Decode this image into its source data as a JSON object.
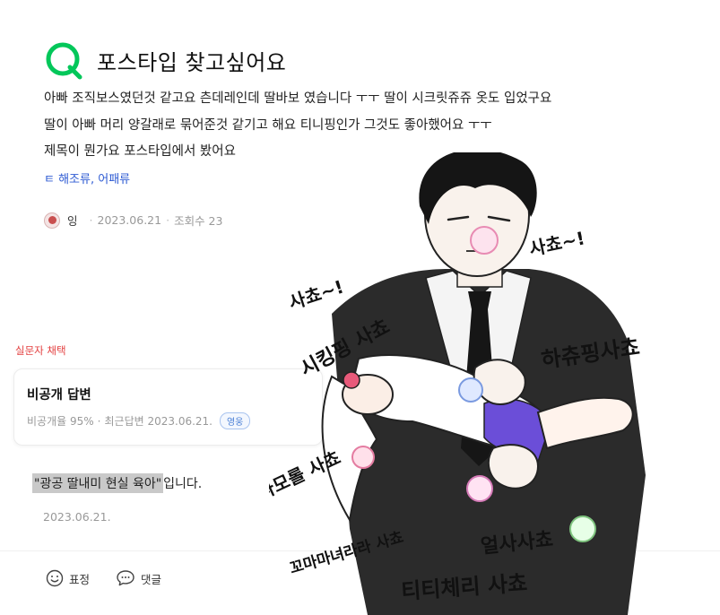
{
  "question": {
    "title": "포스타입 찾고싶어요",
    "lines": [
      "아빠 조직보스였던것 같고요 츤데레인데 딸바보 였습니다 ㅜㅜ 딸이 시크릿쥬쥬 옷도 입었구요",
      "딸이 아빠 머리 양갈래로 묶어준것 같기고 해요 티니핑인가 그것도 좋아했어요 ㅜㅜ",
      "제목이 뭔가요 포스타입에서 봤어요"
    ],
    "tags": "ㅌ 해조류, 어패류",
    "author": "잉",
    "date": "2023.06.21",
    "views": "조회수 23"
  },
  "answer": {
    "chosen_label": "실문자 채택",
    "card_title": "비공개 답변",
    "adopt_rate": "비공개율 95%",
    "recent": "최근답변 2023.06.21.",
    "badge": "영웅",
    "text_highlight": "\"광공 딸내미 현실 육아\"",
    "text_suffix": "입니다.",
    "date": "2023.06.21."
  },
  "actions": {
    "react": "표정",
    "comment": "댓글"
  },
  "illustration": {
    "captions": [
      "사쵸~!",
      "사쵸~!",
      "시킹핑 사쵸",
      "하츄핑사쵸",
      "시나모롤 사쵸",
      "꼬마마녀라라 사쵸",
      "얼사사쵸",
      "티티체리 사쵸"
    ]
  },
  "colors": {
    "brand_green": "#03c75a",
    "link_blue": "#2e5bd3",
    "chosen_red": "#e34141"
  }
}
